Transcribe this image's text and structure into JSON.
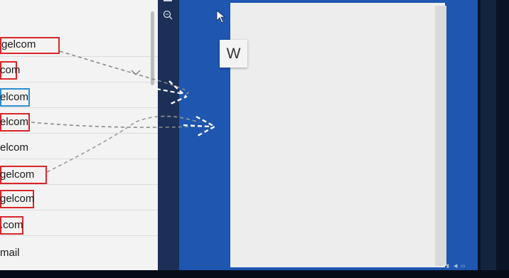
{
  "contacts": [
    {
      "text": "gelcom",
      "highlight": "red"
    },
    {
      "text": "com",
      "highlight": "red"
    },
    {
      "text": "elcom",
      "highlight": "blue"
    },
    {
      "text": "elcom",
      "highlight": "red"
    },
    {
      "text": "elcom",
      "highlight": "none"
    },
    {
      "text": "gelcom",
      "highlight": "red"
    },
    {
      "text": "gelcom",
      "highlight": "red"
    },
    {
      "text": ".com",
      "highlight": "red"
    },
    {
      "text": "mail",
      "highlight": "none"
    }
  ],
  "document": {
    "app_tile_letter": "W"
  },
  "icons": [
    "menu-icon",
    "zoom-icon",
    "chevron-down-icon",
    "mouse-pointer-icon",
    "arrow-icon"
  ],
  "colors": {
    "highlight_red": "#d9262b",
    "highlight_blue": "#2a8fd0",
    "app_blue": "#1e56b0",
    "document": "#ededed"
  }
}
